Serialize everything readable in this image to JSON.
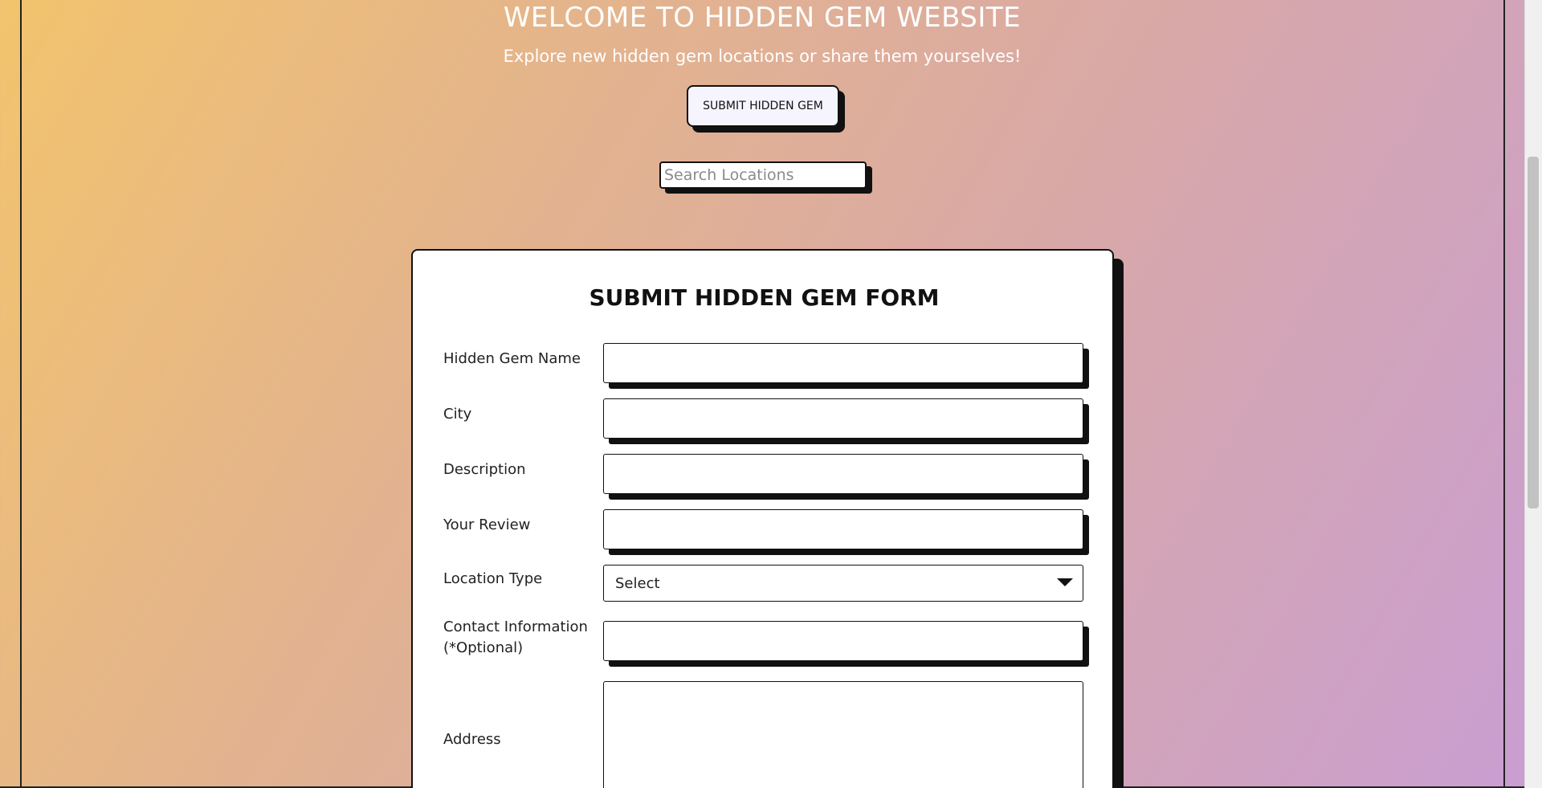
{
  "header": {
    "title": "WELCOME TO HIDDEN GEM WEBSITE",
    "subtitle": "Explore new hidden gem locations or share them yourselves!"
  },
  "submit_button": {
    "label": "SUBMIT HIDDEN GEM"
  },
  "search": {
    "placeholder": "Search Locations",
    "value": ""
  },
  "form": {
    "title": "SUBMIT HIDDEN GEM FORM",
    "fields": {
      "name": {
        "label": "Hidden Gem Name",
        "value": ""
      },
      "city": {
        "label": "City",
        "value": ""
      },
      "description": {
        "label": "Description",
        "value": ""
      },
      "review": {
        "label": "Your Review",
        "value": ""
      },
      "location_type": {
        "label": "Location Type",
        "selected": "Select"
      },
      "contact": {
        "label_line1": "Contact Information",
        "label_line2": "(*Optional)",
        "value": ""
      },
      "address": {
        "label": "Address",
        "value": ""
      }
    }
  },
  "colors": {
    "gradient_start": "#f2c46d",
    "gradient_end": "#c99ed2",
    "text_light": "#ffffff",
    "ink": "#111111"
  }
}
